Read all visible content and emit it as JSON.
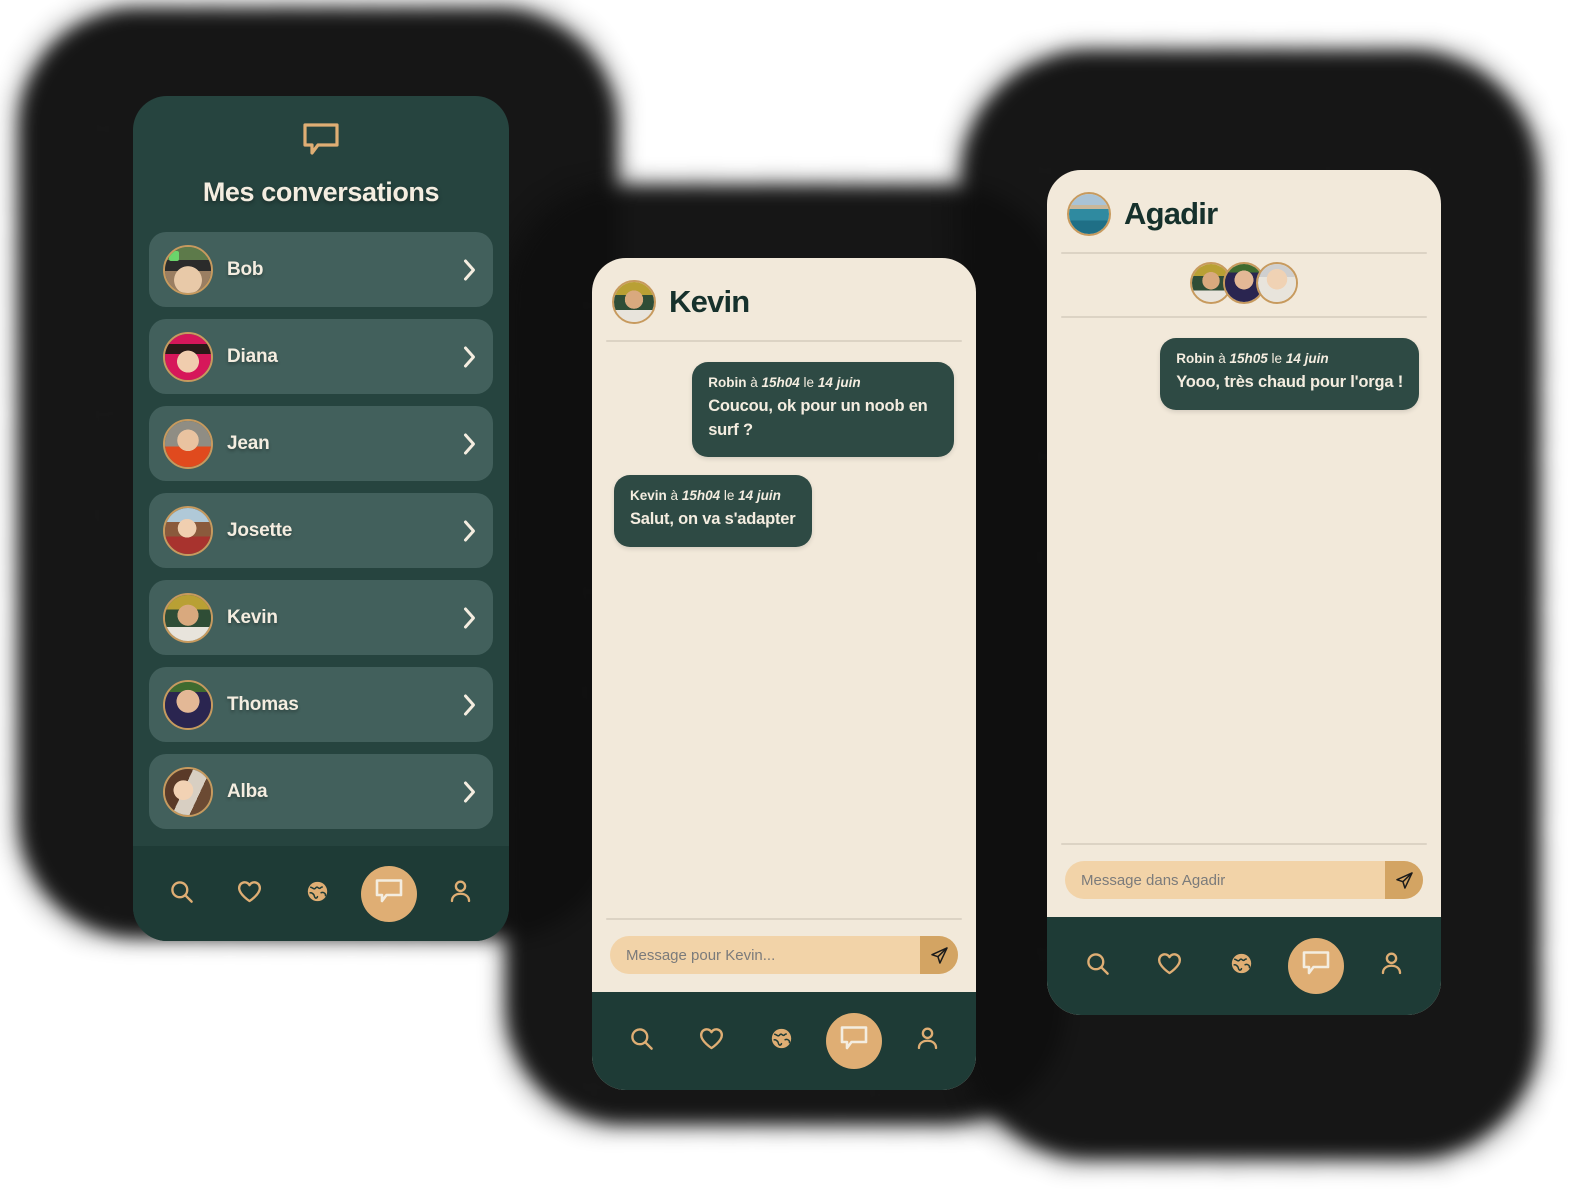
{
  "theme": {
    "dark_teal": "#26443F",
    "card_teal": "#42605C",
    "nav_teal": "#1E3B36",
    "cream": "#F2E9DA",
    "accent_tan": "#DFAE74",
    "input_tan": "#F2D3A8",
    "send_tan": "#D3A463",
    "avatar_ring": "#C79A5E",
    "bubble_teal": "#2E4A44",
    "text_cream": "#F4EDE0",
    "text_dark": "#16312C"
  },
  "phone1": {
    "header": {
      "icon": "speech-bubble-icon",
      "title": "Mes conversations"
    },
    "conversations": [
      {
        "name": "Bob",
        "avatar": "bob-avatar",
        "chevron": "chevron-right-icon"
      },
      {
        "name": "Diana",
        "avatar": "diana-avatar",
        "chevron": "chevron-right-icon"
      },
      {
        "name": "Jean",
        "avatar": "jean-avatar",
        "chevron": "chevron-right-icon"
      },
      {
        "name": "Josette",
        "avatar": "josette-avatar",
        "chevron": "chevron-right-icon"
      },
      {
        "name": "Kevin",
        "avatar": "kevin-avatar",
        "chevron": "chevron-right-icon"
      },
      {
        "name": "Thomas",
        "avatar": "thomas-avatar",
        "chevron": "chevron-right-icon"
      },
      {
        "name": "Alba",
        "avatar": "alba-avatar",
        "chevron": "chevron-right-icon"
      }
    ],
    "nav": {
      "items": [
        {
          "icon": "search-icon",
          "active": false
        },
        {
          "icon": "heart-icon",
          "active": false
        },
        {
          "icon": "globe-icon",
          "active": false
        },
        {
          "icon": "chat-icon",
          "active": true
        },
        {
          "icon": "person-icon",
          "active": false
        }
      ]
    }
  },
  "phone2": {
    "header": {
      "title": "Kevin",
      "avatar": "kevin-avatar"
    },
    "messages": [
      {
        "author": "Robin",
        "prep": "à",
        "time": "15h04",
        "mid": "le",
        "date": "14 juin",
        "text": "Coucou, ok pour un noob en surf ?",
        "side": "right"
      },
      {
        "author": "Kevin",
        "prep": "à",
        "time": "15h04",
        "mid": "le",
        "date": "14 juin",
        "text": "Salut, on va s'adapter",
        "side": "left"
      }
    ],
    "composer": {
      "placeholder": "Message pour Kevin...",
      "value": "",
      "send_icon": "send-paper-plane-icon"
    },
    "nav": {
      "items": [
        {
          "icon": "search-icon",
          "active": false
        },
        {
          "icon": "heart-icon",
          "active": false
        },
        {
          "icon": "globe-icon",
          "active": false
        },
        {
          "icon": "chat-icon",
          "active": true
        },
        {
          "icon": "person-icon",
          "active": false
        }
      ]
    }
  },
  "phone3": {
    "header": {
      "title": "Agadir",
      "avatar": "agadir-group-avatar"
    },
    "group_members": [
      {
        "avatar": "kevin-avatar"
      },
      {
        "avatar": "thomas-avatar"
      },
      {
        "avatar": "robin-avatar"
      }
    ],
    "messages": [
      {
        "author": "Robin",
        "prep": "à",
        "time": "15h05",
        "mid": "le",
        "date": "14 juin",
        "text": "Yooo, très chaud pour l'orga !",
        "side": "right"
      }
    ],
    "composer": {
      "placeholder": "Message dans Agadir",
      "value": "",
      "send_icon": "send-paper-plane-icon"
    },
    "nav": {
      "items": [
        {
          "icon": "search-icon",
          "active": false
        },
        {
          "icon": "heart-icon",
          "active": false
        },
        {
          "icon": "globe-icon",
          "active": false
        },
        {
          "icon": "chat-icon",
          "active": true
        },
        {
          "icon": "person-icon",
          "active": false
        }
      ]
    }
  }
}
